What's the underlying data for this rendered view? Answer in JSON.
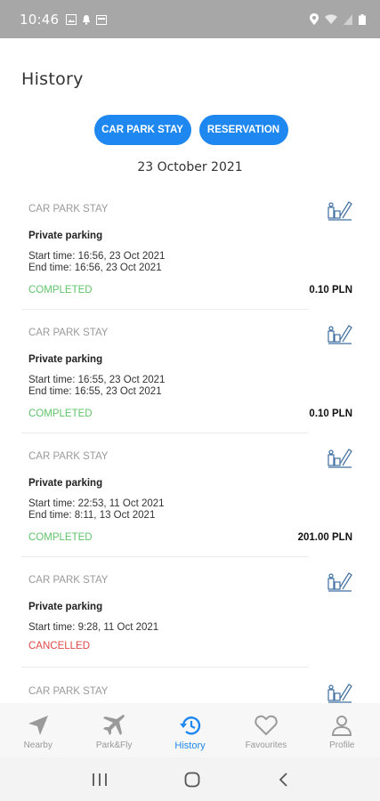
{
  "status_bar": {
    "time": "10:46"
  },
  "page": {
    "title": "History",
    "date_heading": "23 October 2021"
  },
  "tabs": [
    {
      "label": "CAR PARK STAY"
    },
    {
      "label": "RESERVATION"
    }
  ],
  "colors": {
    "accent": "#1e88f0",
    "completed": "#5fc46a",
    "cancelled": "#e24848"
  },
  "history_items": [
    {
      "type": "CAR PARK STAY",
      "icon": "parking-icon",
      "name": "Private parking",
      "start": "Start time: 16:56, 23 Oct 2021",
      "end": "End time: 16:56, 23 Oct 2021",
      "status": "COMPLETED",
      "price": "0.10 PLN"
    },
    {
      "type": "CAR PARK STAY",
      "icon": "parking-icon",
      "name": "Private parking",
      "start": "Start time: 16:55, 23 Oct 2021",
      "end": "End time: 16:55, 23 Oct 2021",
      "status": "COMPLETED",
      "price": "0.10 PLN"
    },
    {
      "type": "CAR PARK STAY",
      "icon": "parking-icon",
      "name": "Private parking",
      "start": "Start time: 22:53, 11 Oct 2021",
      "end": "End time: 8:11, 13 Oct 2021",
      "status": "COMPLETED",
      "price": "201.00 PLN"
    },
    {
      "type": "CAR PARK STAY",
      "icon": "parking-icon",
      "name": "Private parking",
      "start": "Start time: 9:28, 11 Oct 2021",
      "status": "CANCELLED"
    },
    {
      "type": "CAR PARK STAY",
      "icon": "parking-icon"
    }
  ],
  "bottom_nav": [
    {
      "label": "Nearby",
      "icon": "navigation-arrow-icon"
    },
    {
      "label": "Park&Fly",
      "icon": "airplane-icon"
    },
    {
      "label": "History",
      "icon": "history-icon",
      "active": true
    },
    {
      "label": "Favourites",
      "icon": "heart-icon"
    },
    {
      "label": "Profile",
      "icon": "person-icon"
    }
  ]
}
